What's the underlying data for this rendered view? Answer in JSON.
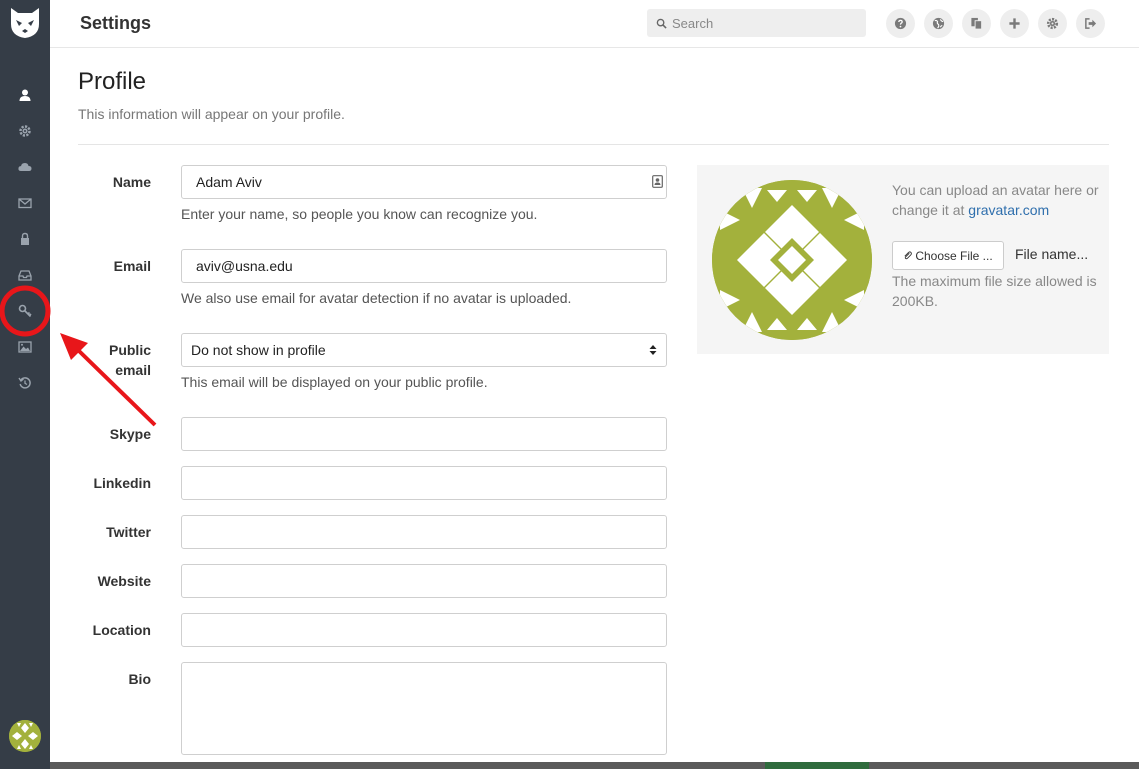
{
  "header": {
    "title": "Settings",
    "search_placeholder": "Search",
    "icons": [
      "help-icon",
      "globe-icon",
      "copy-icon",
      "plus-icon",
      "gear-icon",
      "sign-out-icon"
    ]
  },
  "sidebar": {
    "items": [
      {
        "icon": "user-icon"
      },
      {
        "icon": "gear-icon"
      },
      {
        "icon": "cloud-icon"
      },
      {
        "icon": "envelope-icon"
      },
      {
        "icon": "lock-icon"
      },
      {
        "icon": "inbox-icon"
      },
      {
        "icon": "key-icon"
      },
      {
        "icon": "image-icon"
      },
      {
        "icon": "history-icon"
      }
    ]
  },
  "profile": {
    "title": "Profile",
    "subtitle": "This information will appear on your profile.",
    "fields": {
      "name": {
        "label": "Name",
        "value": "Adam Aviv",
        "help": "Enter your name, so people you know can recognize you."
      },
      "email": {
        "label": "Email",
        "value": "aviv@usna.edu",
        "help": "We also use email for avatar detection if no avatar is uploaded."
      },
      "public_email": {
        "label_line1": "Public",
        "label_line2": "email",
        "value": "Do not show in profile",
        "help": "This email will be displayed on your public profile."
      },
      "skype": {
        "label": "Skype",
        "value": ""
      },
      "linkedin": {
        "label": "Linkedin",
        "value": ""
      },
      "twitter": {
        "label": "Twitter",
        "value": ""
      },
      "website": {
        "label": "Website",
        "value": ""
      },
      "location": {
        "label": "Location",
        "value": ""
      },
      "bio": {
        "label": "Bio",
        "value": ""
      }
    }
  },
  "avatar": {
    "text_before": "You can upload an avatar here or change it at ",
    "link": "gravatar.com",
    "choose_label": "Choose File ...",
    "file_name": "File name...",
    "size_note": "The maximum file size allowed is 200KB."
  },
  "colors": {
    "sidebar_bg": "#353d47",
    "avatar_green": "#a3b13c",
    "annotation_red": "#e8161a"
  }
}
